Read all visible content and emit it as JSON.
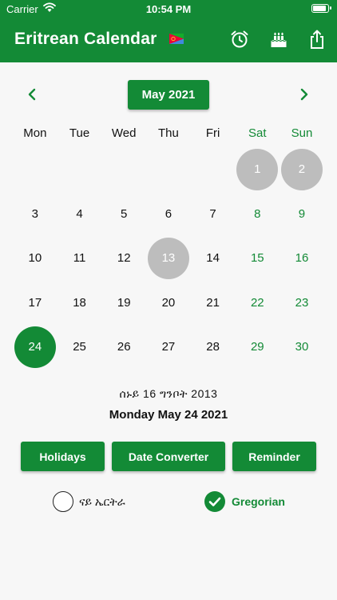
{
  "status_bar": {
    "carrier": "Carrier",
    "time": "10:54 PM"
  },
  "header": {
    "title": "Eritrean Calendar",
    "flag_icon": "eritrea-flag-icon",
    "icons": [
      "alarm-clock-icon",
      "birthday-cake-icon",
      "share-icon"
    ]
  },
  "calendar": {
    "month_label": "May 2021",
    "prev_icon": "chevron-left-icon",
    "next_icon": "chevron-right-icon",
    "weekdays": [
      "Mon",
      "Tue",
      "Wed",
      "Thu",
      "Fri",
      "Sat",
      "Sun"
    ],
    "weeks": [
      [
        "",
        "",
        "",
        "",
        "",
        "1",
        "2"
      ],
      [
        "3",
        "4",
        "5",
        "6",
        "7",
        "8",
        "9"
      ],
      [
        "10",
        "11",
        "12",
        "13",
        "14",
        "15",
        "16"
      ],
      [
        "17",
        "18",
        "19",
        "20",
        "21",
        "22",
        "23"
      ],
      [
        "24",
        "25",
        "26",
        "27",
        "28",
        "29",
        "30"
      ]
    ],
    "highlighted_days": [
      "1",
      "2",
      "13"
    ],
    "selected_day": "24"
  },
  "ethiopic_date": "ሰኑይ 16 ግንቦት 2013",
  "gregorian_date": "Monday May 24 2021",
  "actions": {
    "holidays": "Holidays",
    "date_converter": "Date Converter",
    "reminder": "Reminder"
  },
  "mode": {
    "eritrean_label": "ናይ ኤርትራ",
    "gregorian_label": "Gregorian",
    "selected": "Gregorian"
  },
  "colors": {
    "accent": "#138a36",
    "highlight_gray": "#bdbdbd",
    "background": "#f7f7f7"
  }
}
